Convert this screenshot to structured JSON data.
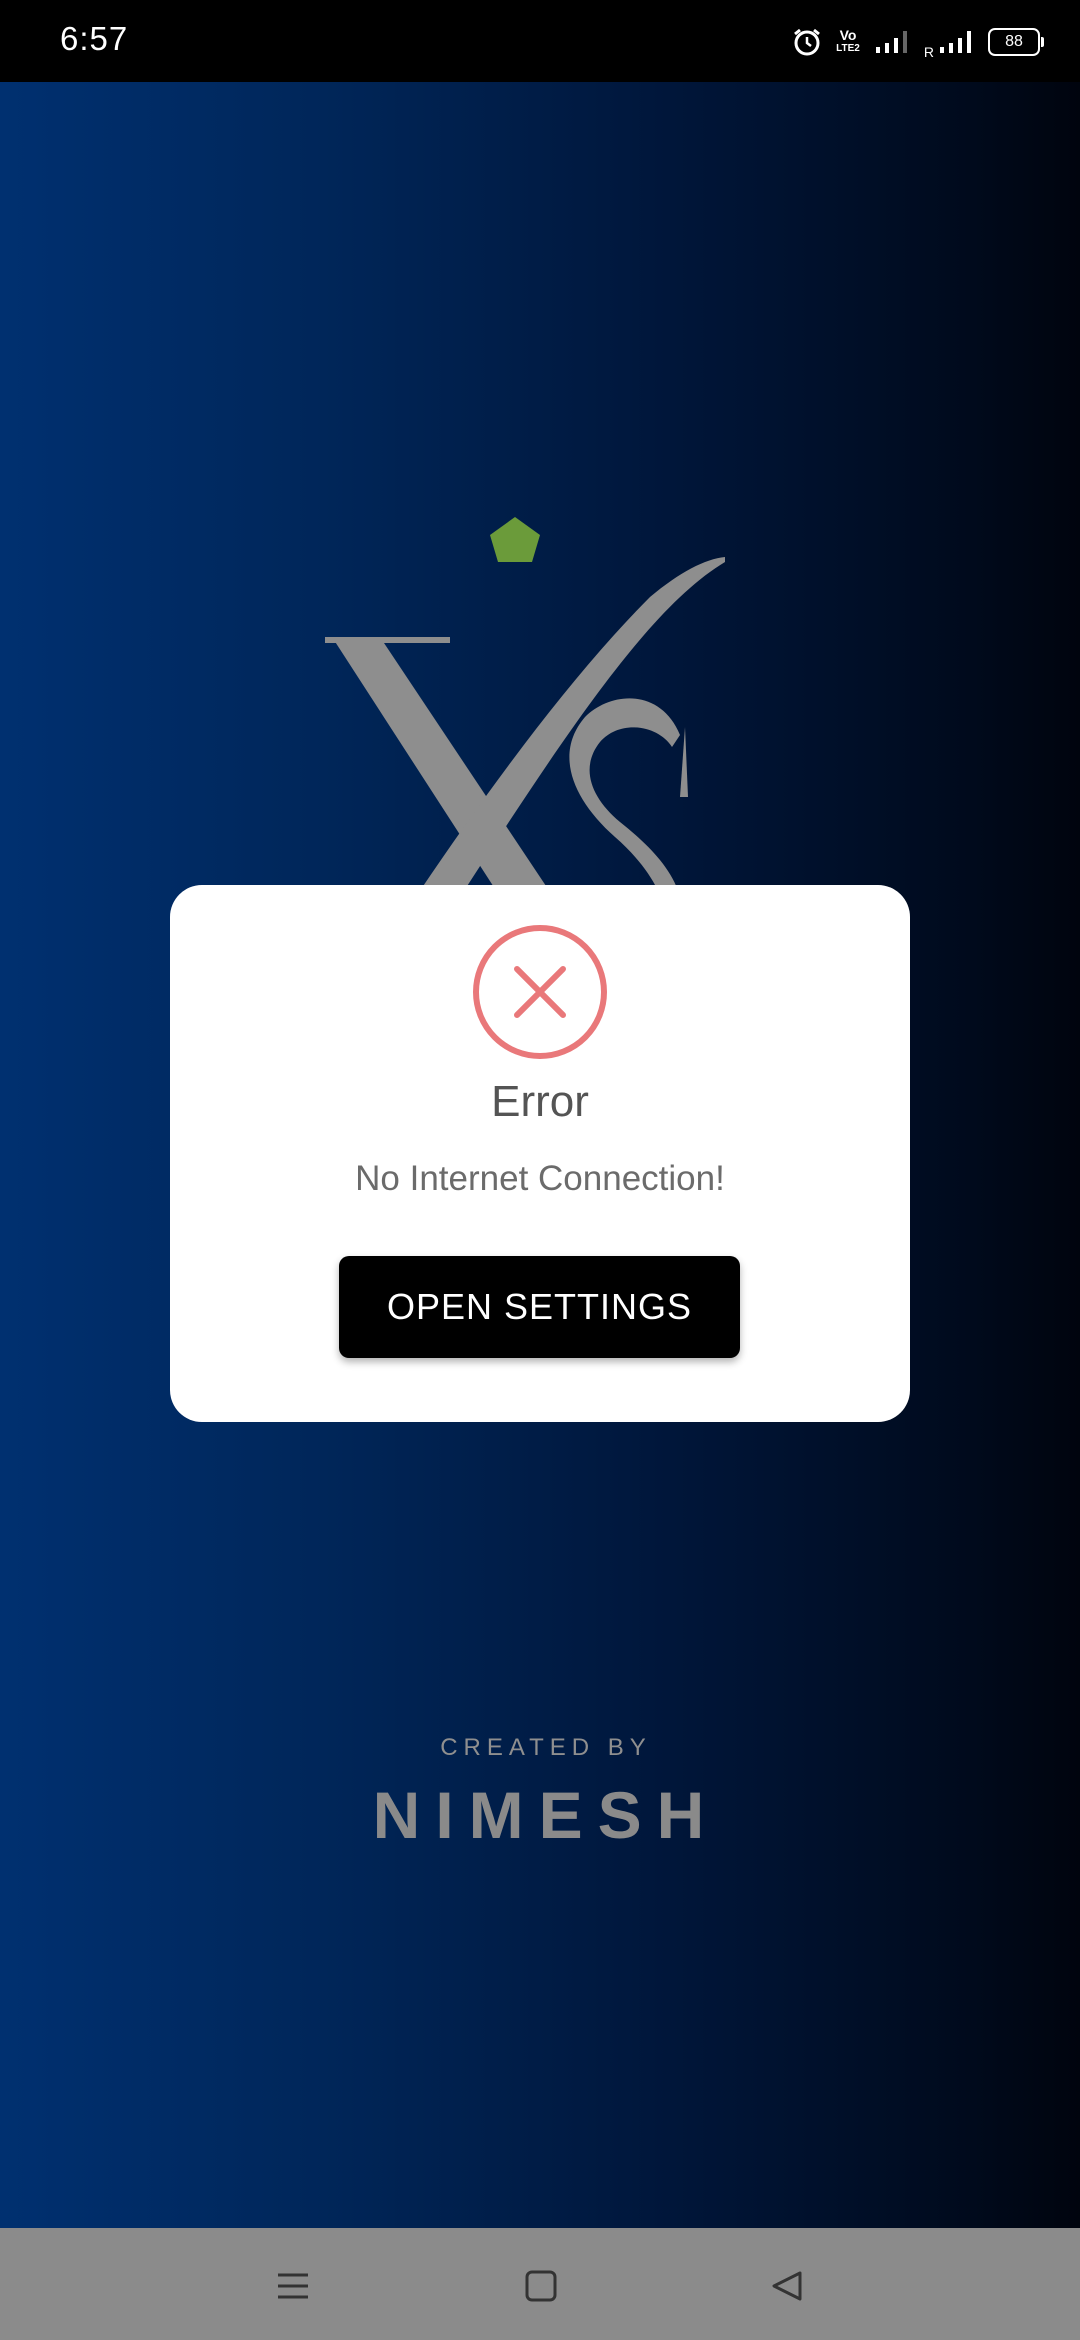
{
  "status_bar": {
    "time": "6:57",
    "vol_top": "Vo",
    "vol_bottom": "LTE2",
    "roaming": "R",
    "battery": "88"
  },
  "splash": {
    "logo_text": "XS",
    "created_by_label": "CREATED BY",
    "creator_name": "NIMESH"
  },
  "dialog": {
    "icon": "error-x-circle-icon",
    "title": "Error",
    "message": "No Internet Connection!",
    "button_label": "OPEN SETTINGS",
    "error_color": "#e9787a"
  },
  "nav_bar": {
    "recents": "menu-icon",
    "home": "square-icon",
    "back": "triangle-back-icon"
  }
}
